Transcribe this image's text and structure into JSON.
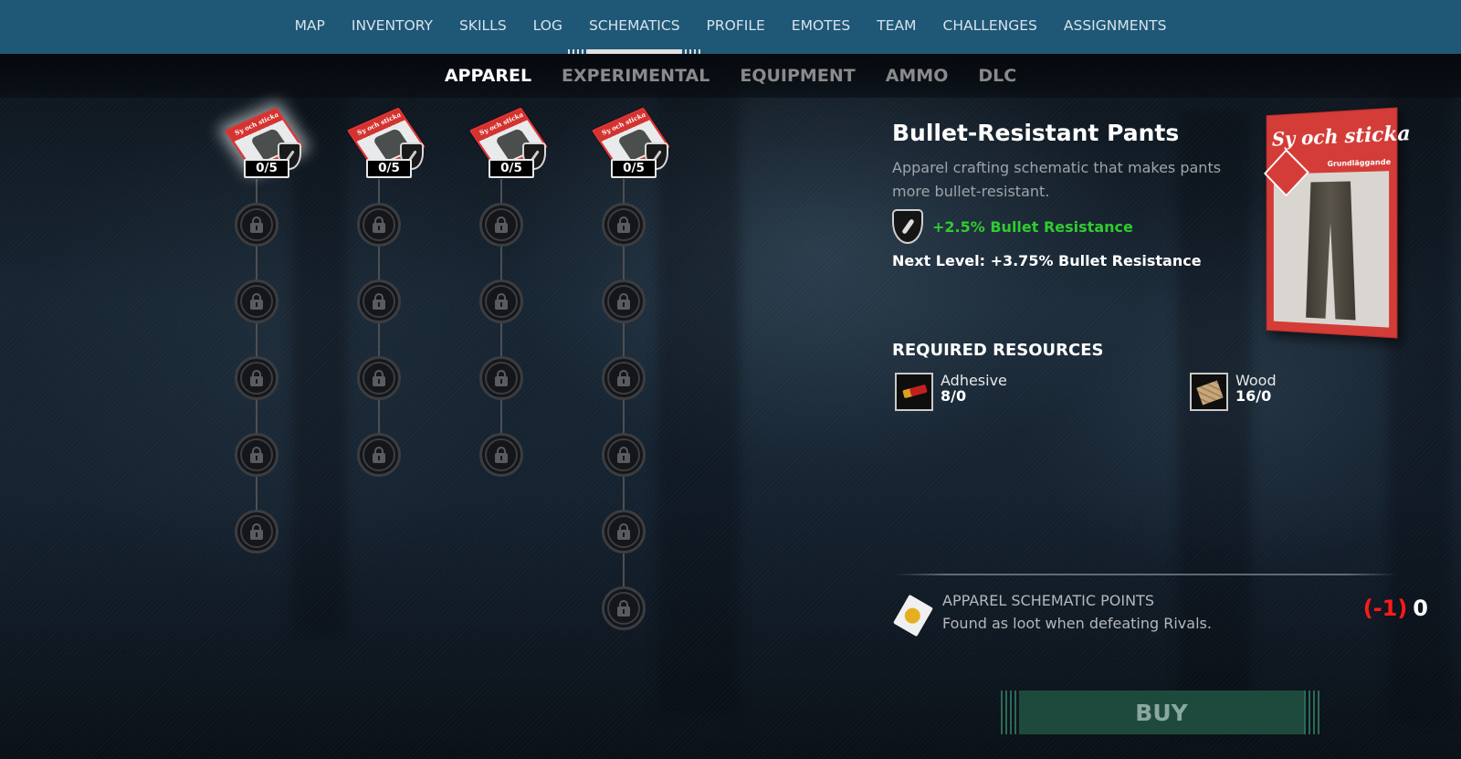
{
  "top_nav": {
    "items": [
      "MAP",
      "INVENTORY",
      "SKILLS",
      "LOG",
      "SCHEMATICS",
      "PROFILE",
      "EMOTES",
      "TEAM",
      "CHALLENGES",
      "ASSIGNMENTS"
    ],
    "active": "SCHEMATICS"
  },
  "sub_tabs": {
    "items": [
      "APPAREL",
      "EXPERIMENTAL",
      "EQUIPMENT",
      "AMMO",
      "DLC"
    ],
    "active": "APPAREL"
  },
  "tree": {
    "columns": [
      {
        "item": "pants",
        "progress": "0/5",
        "locked_nodes": 5,
        "selected": true
      },
      {
        "item": "shirt",
        "progress": "0/5",
        "locked_nodes": 4,
        "selected": false
      },
      {
        "item": "jacket",
        "progress": "0/5",
        "locked_nodes": 4,
        "selected": false
      },
      {
        "item": "boots",
        "progress": "0/5",
        "locked_nodes": 6,
        "selected": false
      }
    ],
    "schematic_mag_title": "Sy och sticka"
  },
  "detail": {
    "title": "Bullet-Resistant Pants",
    "description": "Apparel crafting schematic that makes pants more bullet-resistant.",
    "bonus_icon": "bullet-shield-icon",
    "bonus": "+2.5% Bullet Resistance",
    "next_level": "Next Level: +3.75% Bullet Resistance",
    "magazine": {
      "title": "Sy och sticka",
      "subtitle": "Grundläggande"
    },
    "required_resources_title": "REQUIRED RESOURCES",
    "resources": [
      {
        "name": "Adhesive",
        "qty": "8/0",
        "icon": "adhesive-icon"
      },
      {
        "name": "Wood",
        "qty": "16/0",
        "icon": "wood-icon"
      }
    ],
    "points": {
      "label": "APPAREL SCHEMATIC POINTS",
      "description": "Found as loot when defeating Rivals.",
      "cost": "(-1)",
      "have": "0"
    },
    "buy_label": "BUY"
  },
  "colors": {
    "nav_bg": "#1f5776",
    "bonus_green": "#2fcc2f",
    "cost_red": "#ff1a1a",
    "buy_bg": "#1e4a3e"
  }
}
